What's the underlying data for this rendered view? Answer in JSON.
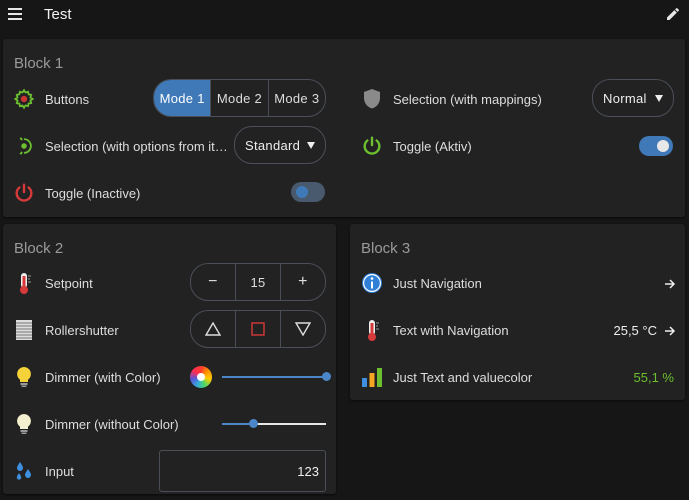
{
  "header": {
    "title": "Test",
    "menu_icon": "hamburger-menu-icon",
    "edit_icon": "pencil-icon"
  },
  "block1": {
    "title": "Block 1",
    "buttons": {
      "label": "Buttons",
      "modes": [
        "Mode 1",
        "Mode 2",
        "Mode 3"
      ],
      "active_index": 0
    },
    "selection_mappings": {
      "label": "Selection (with mappings)",
      "value": "Normal"
    },
    "selection_options": {
      "label": "Selection (with options from ite...",
      "value": "Standard"
    },
    "toggle_active": {
      "label": "Toggle (Aktiv)",
      "on": true
    },
    "toggle_inactive": {
      "label": "Toggle (Inactive)",
      "on": false
    }
  },
  "block2": {
    "title": "Block 2",
    "setpoint": {
      "label": "Setpoint",
      "minus": "−",
      "value": "15",
      "plus": "+"
    },
    "rollershutter": {
      "label": "Rollershutter"
    },
    "dimmer_color": {
      "label": "Dimmer (with Color)",
      "level": 1.0
    },
    "dimmer_plain": {
      "label": "Dimmer (without Color)",
      "level": 0.3
    },
    "input": {
      "label": "Input",
      "value": "123"
    }
  },
  "block3": {
    "title": "Block 3",
    "nav": {
      "label": "Just Navigation"
    },
    "text_nav": {
      "label": "Text with Navigation",
      "value": "25,5 °C"
    },
    "text_color": {
      "label": "Just Text and valuecolor",
      "value": "55,1 %"
    }
  },
  "colors": {
    "accent": "#3f79b8",
    "green": "#6cbf2f",
    "red": "#d63a3a",
    "card": "#222222",
    "bg": "#161616"
  }
}
